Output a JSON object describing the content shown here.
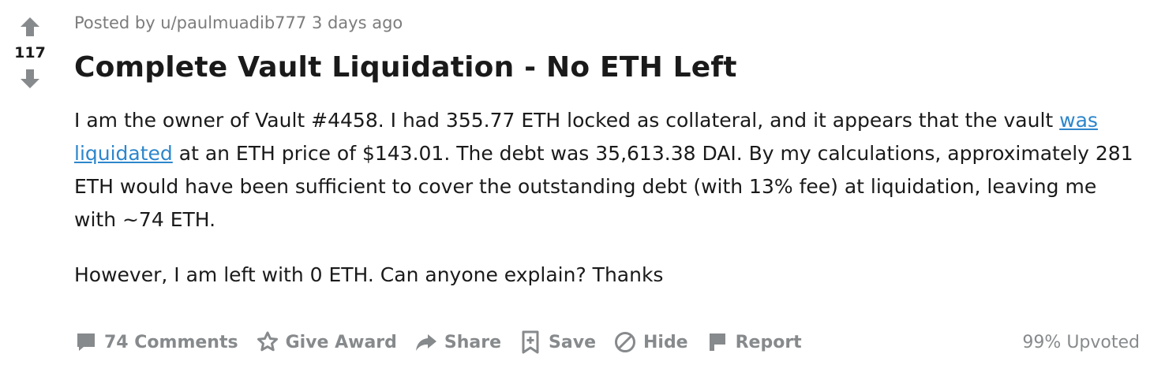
{
  "vote": {
    "score": "117"
  },
  "post": {
    "meta": {
      "prefix": "Posted by ",
      "author": "u/paulmuadib777",
      "time": "3 days ago"
    },
    "title": "Complete Vault Liquidation - No ETH Left",
    "body": {
      "p1_before_link": "I am the owner of Vault #4458. I had 355.77 ETH locked as collateral, and it appears that the vault ",
      "p1_link": "was liquidated",
      "p1_after_link": " at an ETH price of $143.01. The debt was 35,613.38 DAI. By my calculations, approximately 281 ETH would have been sufficient to cover the outstanding debt (with 13% fee) at liquidation, leaving me with ~74 ETH.",
      "p2": "However, I am left with 0 ETH. Can anyone explain? Thanks"
    }
  },
  "actions": {
    "comments": "74 Comments",
    "award": "Give Award",
    "share": "Share",
    "save": "Save",
    "hide": "Hide",
    "report": "Report",
    "upvoted": "99% Upvoted"
  },
  "icons": {
    "upvote": "arrow-up-icon",
    "downvote": "arrow-down-icon",
    "comments": "comment-bubble-icon",
    "award": "award-star-icon",
    "share": "share-arrow-icon",
    "save": "bookmark-plus-icon",
    "hide": "hide-circle-slash-icon",
    "report": "flag-icon"
  },
  "colors": {
    "text": "#1a1a1b",
    "meta": "#7c7c7c",
    "muted_action": "#878a8c",
    "vote_arrow": "#878a8c",
    "link": "#2d86cc",
    "background": "#ffffff"
  }
}
